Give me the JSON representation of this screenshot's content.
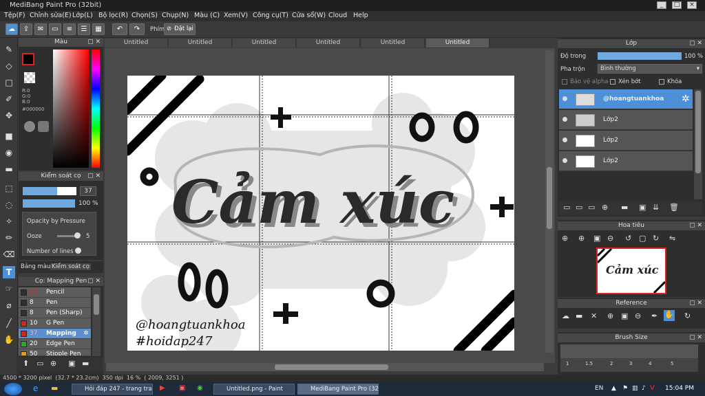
{
  "app": {
    "title": "MediBang Paint Pro (32bit)"
  },
  "menu": [
    "Tệp(F)",
    "Chỉnh sửa(E)",
    "Lớp(L)",
    "Bộ lọc(R)",
    "Chọn(S)",
    "Chụp(N)",
    "Màu (C)",
    "Xem(V)",
    "Công cụ(T)",
    "Cửa sổ(W)",
    "Cloud",
    "Help"
  ],
  "toolbar": {
    "phim_label": "Phím",
    "reset_label": "Đặt lại"
  },
  "color_panel": {
    "title": "Màu",
    "r": "R:0",
    "g": "G:0",
    "b": "B:0",
    "hex": "#000000"
  },
  "control_panel": {
    "title": "Kiểm soát cọ",
    "size_value": "37",
    "opacity_value": "100 %",
    "opacity_pressure": "Opacity by Pressure",
    "ooze": "Ooze",
    "ooze_value": "5",
    "number_of_lines": "Number of lines"
  },
  "palette_tabs": {
    "left": "Bảng màu",
    "right": "Kiểm soát cọ"
  },
  "brush_panel": {
    "title": "Cọ: Mapping Pen",
    "items": [
      {
        "size": "22",
        "name": "Pencil",
        "color": "#303030"
      },
      {
        "size": "8",
        "name": "Pen",
        "color": "#303030"
      },
      {
        "size": "8",
        "name": "Pen (Sharp)",
        "color": "#303030"
      },
      {
        "size": "10",
        "name": "G Pen",
        "color": "#e02020"
      },
      {
        "size": "37",
        "name": "Mapping Pen",
        "color": "#e02020"
      },
      {
        "size": "20",
        "name": "Edge Pen",
        "color": "#20b020"
      },
      {
        "size": "50",
        "name": "Stipple Pen",
        "color": "#e0a020"
      }
    ]
  },
  "tabs": [
    "Untitled",
    "Untitled",
    "Untitled",
    "Untitled",
    "Untitled",
    "Untitled"
  ],
  "canvas": {
    "main_text": "Cảm xúc",
    "handle": "@hoangtuankhoa",
    "hashtag": "#hoidap247"
  },
  "layer_panel": {
    "title": "Lớp",
    "opacity_label": "Độ trong",
    "opacity_value": "100 %",
    "blend_label": "Pha trộn",
    "blend_value": "Bình thường",
    "protect_alpha": "Bảo vệ alpha",
    "clip": "Xén bớt",
    "lock": "Khóa",
    "layers": [
      "@hoangtuankhoa",
      "Lớp2",
      "Lớp2",
      "Lớp2"
    ]
  },
  "navigator": {
    "title": "Hoa tiêu"
  },
  "reference": {
    "title": "Reference"
  },
  "brush_size": {
    "title": "Brush Size",
    "sizes": [
      "1",
      "1.5",
      "2",
      "3",
      "4",
      "5"
    ]
  },
  "status": {
    "text": "4500 * 3200 pixel  (32.7 * 23.2cm)  350 dpi  16 %  ( 2009, 3251 )"
  },
  "taskbar": {
    "tasks": [
      "Hỏi đáp 247 - trang tra ...",
      "Untitled.png - Paint",
      "MediBang Paint Pro (32..."
    ],
    "lang": "EN",
    "time": "15:04 PM"
  },
  "colors": {
    "accent": "#4d90d8",
    "panel": "#3a3a3a"
  }
}
